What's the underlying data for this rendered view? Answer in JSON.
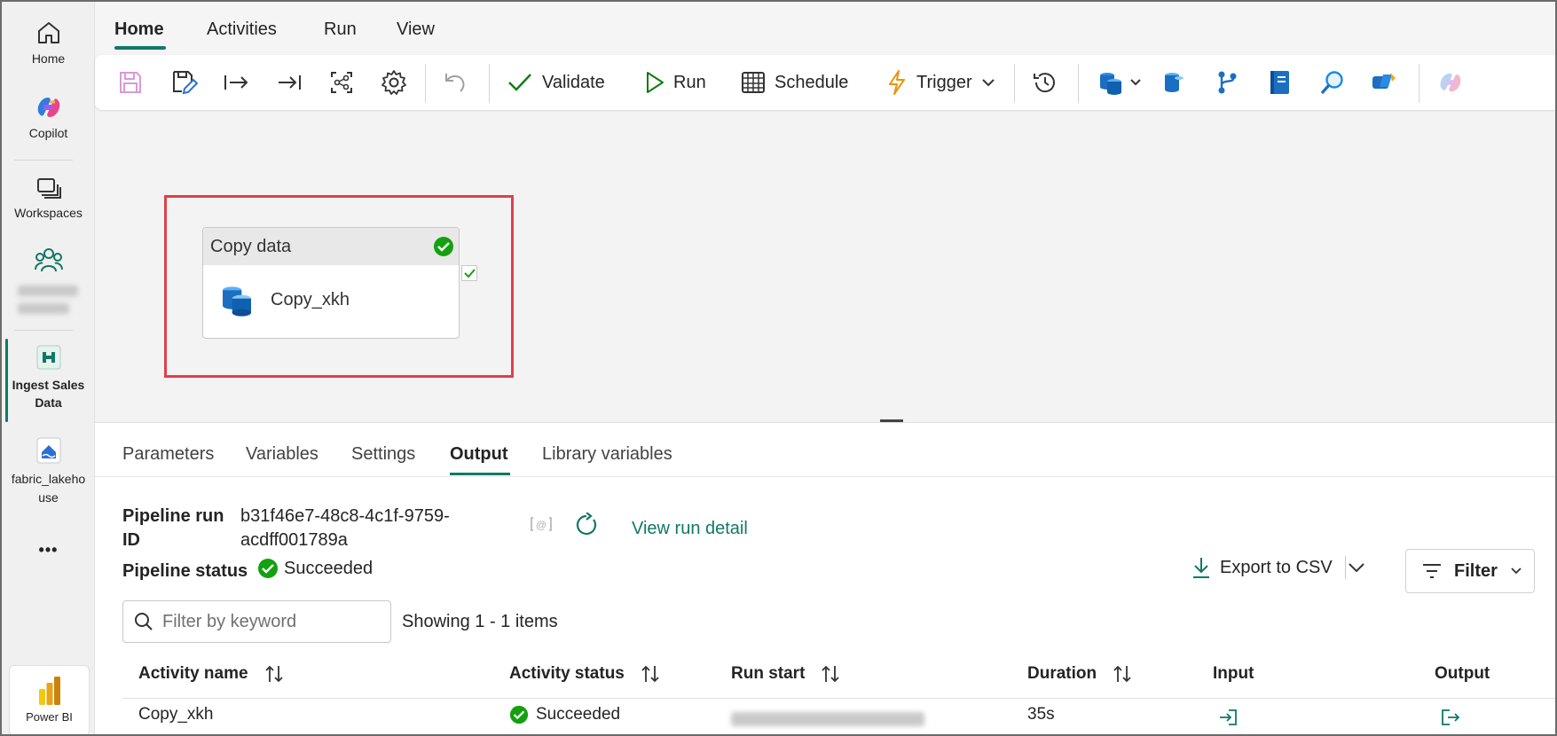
{
  "rail": {
    "home": "Home",
    "copilot": "Copilot",
    "workspaces": "Workspaces",
    "ingest": "Ingest Sales Data",
    "lakehouse": "fabric_lakehouse",
    "more": "•••",
    "powerbi": "Power BI"
  },
  "menu": {
    "tabs": [
      "Home",
      "Activities",
      "Run",
      "View"
    ]
  },
  "toolbar": {
    "validate": "Validate",
    "run": "Run",
    "schedule": "Schedule",
    "trigger": "Trigger"
  },
  "canvas": {
    "activity_type": "Copy data",
    "activity_name": "Copy_xkh"
  },
  "panel": {
    "tabs": [
      "Parameters",
      "Variables",
      "Settings",
      "Output",
      "Library variables"
    ],
    "run_id_label_1": "Pipeline run",
    "run_id_label_2": "ID",
    "run_id_line1": "b31f46e7-48c8-4c1f-9759-",
    "run_id_line2": "acdff001789a",
    "view_run_detail": "View run detail",
    "status_label": "Pipeline status",
    "status_value": "Succeeded",
    "export": "Export to CSV",
    "filter": "Filter",
    "search_placeholder": "Filter by keyword",
    "showing": "Showing 1 - 1 items",
    "columns": [
      "Activity name",
      "Activity status",
      "Run start",
      "Duration",
      "Input",
      "Output"
    ],
    "row": {
      "name": "Copy_xkh",
      "status": "Succeeded",
      "duration": "35s"
    }
  },
  "colors": {
    "accent": "#117865",
    "success": "#0f7b0f",
    "highlight": "#e04048"
  }
}
